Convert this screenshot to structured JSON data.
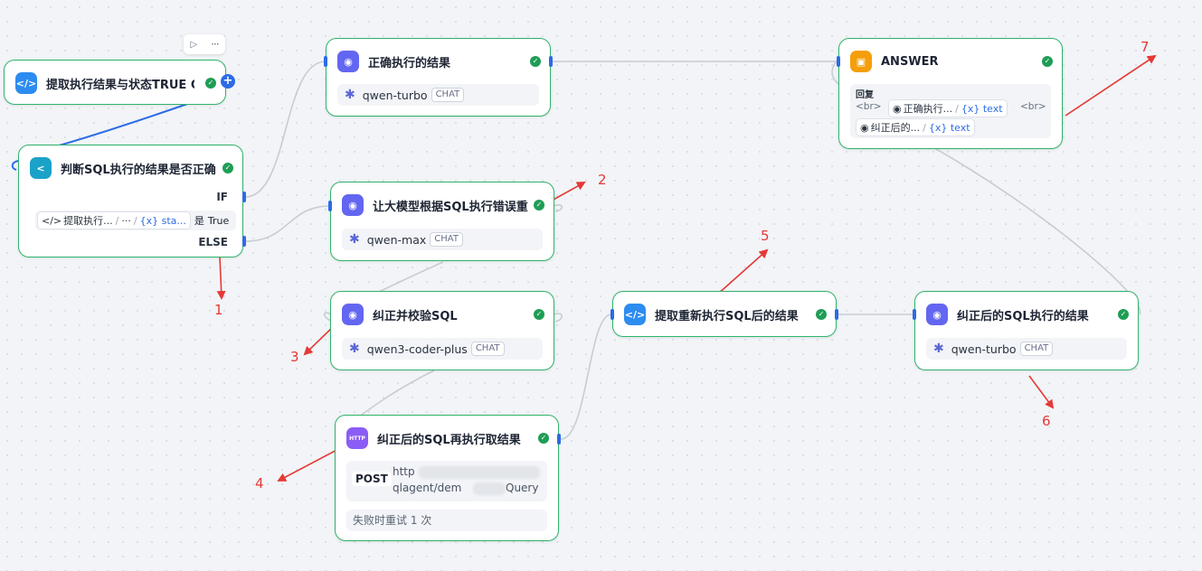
{
  "colors": {
    "node_border": "#2fb36b",
    "wire_gray": "#c8ccd3",
    "wire_blue": "#2d6be6",
    "annotation_red": "#e53935",
    "code_icon": "#2d8cf0",
    "branch_icon": "#1aa2c8",
    "llm_icon": "#6366f1",
    "http_icon": "#8b5cf6",
    "answer_icon": "#f59e0b",
    "success": "#1f9d55"
  },
  "toolbar": {
    "run_icon": "play-icon",
    "more_icon": "more-icon"
  },
  "nodes": {
    "extract_status": {
      "title": "提取执行结果与状态TRUE OR",
      "icon": "code-icon"
    },
    "judge": {
      "title": "判断SQL执行的结果是否正确",
      "if_label": "IF",
      "else_label": "ELSE",
      "cond_source": "提取执行...",
      "cond_sep": "/",
      "cond_more": "···",
      "cond_var": "{x} sta...",
      "cond_op": "是",
      "cond_value": "True"
    },
    "correct_result": {
      "title": "正确执行的结果",
      "model": "qwen-turbo",
      "badge": "CHAT"
    },
    "error_redo": {
      "title": "让大模型根据SQL执行错误重",
      "model": "qwen-max",
      "badge": "CHAT"
    },
    "fix_sql": {
      "title": "纠正并校验SQL",
      "model": "qwen3-coder-plus",
      "badge": "CHAT"
    },
    "http": {
      "title": "纠正后的SQL再执行取结果",
      "method": "POST",
      "url_line1": "http",
      "url_line2": "qlagent/dem",
      "url_tail": "Query",
      "retry": "失败时重试 1 次",
      "icon_text": "HTTP"
    },
    "extract_rerun": {
      "title": "提取重新执行SQL后的结果"
    },
    "fixed_result": {
      "title": "纠正后的SQL执行的结果",
      "model": "qwen-turbo",
      "badge": "CHAT"
    },
    "answer": {
      "title": "ANSWER",
      "label": "回复",
      "br1": "<br>",
      "ref1_name": "正确执行...",
      "ref1_var": "{x} text",
      "br2": "<br>",
      "ref2_name": "纠正后的...",
      "ref2_var": "{x} text"
    }
  },
  "annotations": [
    "1",
    "2",
    "3",
    "4",
    "5",
    "6",
    "7"
  ]
}
